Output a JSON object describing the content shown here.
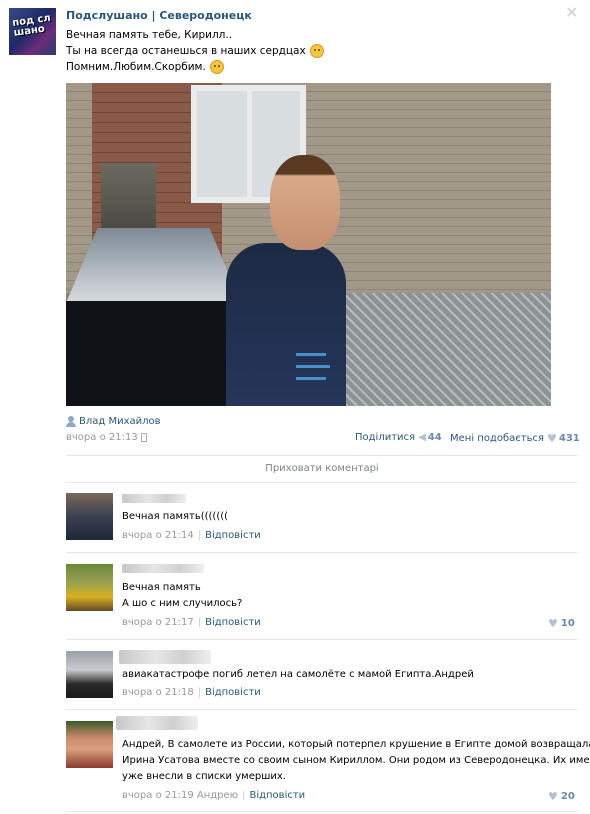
{
  "post": {
    "avatar_text": "под сл шано",
    "group_name": "Подслушано | Северодонецк",
    "text_lines": [
      "Вечная память тебе, Кирилл..",
      "Ты на всегда останешься в наших сердцах",
      "Помним.Любим.Скорбим."
    ],
    "author": "Влад Михайлов",
    "time": "вчора о 21:13",
    "share_label": "Поділитися",
    "share_count": "44",
    "like_label": "Мені подобається",
    "like_count": "431",
    "hide_comments": "Приховати коментарі"
  },
  "comments": [
    {
      "text_lines": [
        "Вечная память((((((("
      ],
      "time": "вчора о 21:14",
      "reply": "Відповісти",
      "likes": ""
    },
    {
      "text_lines": [
        "Вечная память",
        "А шо с ним случилось?"
      ],
      "time": "вчора о 21:17",
      "reply": "Відповісти",
      "likes": "10"
    },
    {
      "text_lines": [
        "авиакатастрофе погиб летел на самолёте с мамой Египта.Андрей"
      ],
      "time": "вчора о 21:18",
      "reply": "Відповісти",
      "likes": ""
    },
    {
      "text_lines": [
        "Андрей, В самолете из России, который потерпел крушение в Египте домой возвращалась",
        "Ирина Усатова вместе со своим сыном Кириллом. Они родом из Северодонецка. Их имена",
        "уже внесли в списки умерших."
      ],
      "time": "вчора о 21:19 Андрею",
      "reply": "Відповісти",
      "likes": "20"
    }
  ]
}
